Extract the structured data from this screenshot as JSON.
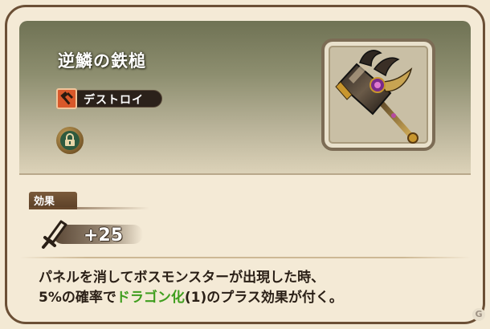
{
  "weapon": {
    "name": "逆鱗の鉄槌",
    "type_label": "デストロイ",
    "type_icon": "hammer-icon",
    "locked": true
  },
  "effect": {
    "tab_label": "効果",
    "stat_icon": "sword-icon",
    "stat_value": "+25",
    "description": {
      "line1": "パネルを消してボスモンスターが出現した時、",
      "line2_pre": "5%の確率で",
      "line2_highlight": "ドラゴン化",
      "line2_post": "(1)のプラス効果が付く。"
    }
  },
  "colors": {
    "highlight": "#3f9e1e",
    "type_badge": "#d9582a",
    "frame": "#6b4f35"
  },
  "watermark": "G"
}
